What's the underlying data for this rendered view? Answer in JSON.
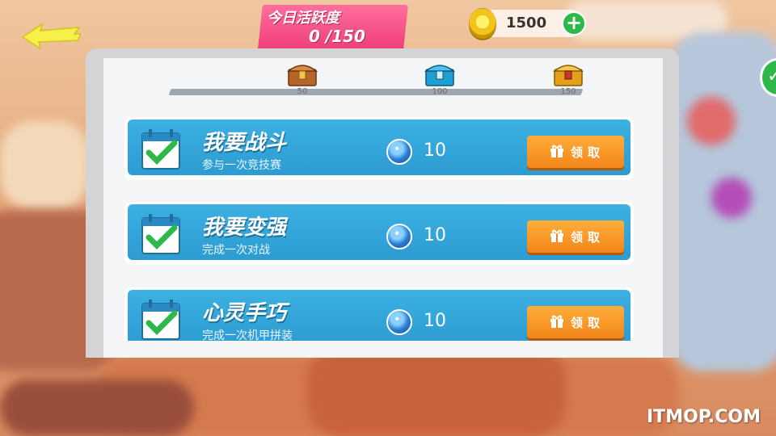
{
  "header": {
    "activity_title": "今日活跃度",
    "activity_value": "0 /150",
    "coins": "1500",
    "add_label": "+"
  },
  "progress": {
    "value": 0,
    "max": 150,
    "milestones": [
      {
        "label": "50",
        "chest": "bronze-chest-icon"
      },
      {
        "label": "100",
        "chest": "blue-chest-icon"
      },
      {
        "label": "150",
        "chest": "gold-chest-icon"
      }
    ]
  },
  "tasks": [
    {
      "title": "我要战斗",
      "subtitle": "参与一次竞技赛",
      "reward": "10",
      "button": "领取"
    },
    {
      "title": "我要变强",
      "subtitle": "完成一次对战",
      "reward": "10",
      "button": "领取"
    },
    {
      "title": "心灵手巧",
      "subtitle": "完成一次机甲拼装",
      "reward": "10",
      "button": "领取"
    }
  ],
  "watermark": "ITMOP.COM",
  "colors": {
    "activity_bg": "#ef3f7c",
    "task_bg": "#2c9bd1",
    "claim_button": "#f2861a",
    "add_button": "#2fb84a"
  }
}
